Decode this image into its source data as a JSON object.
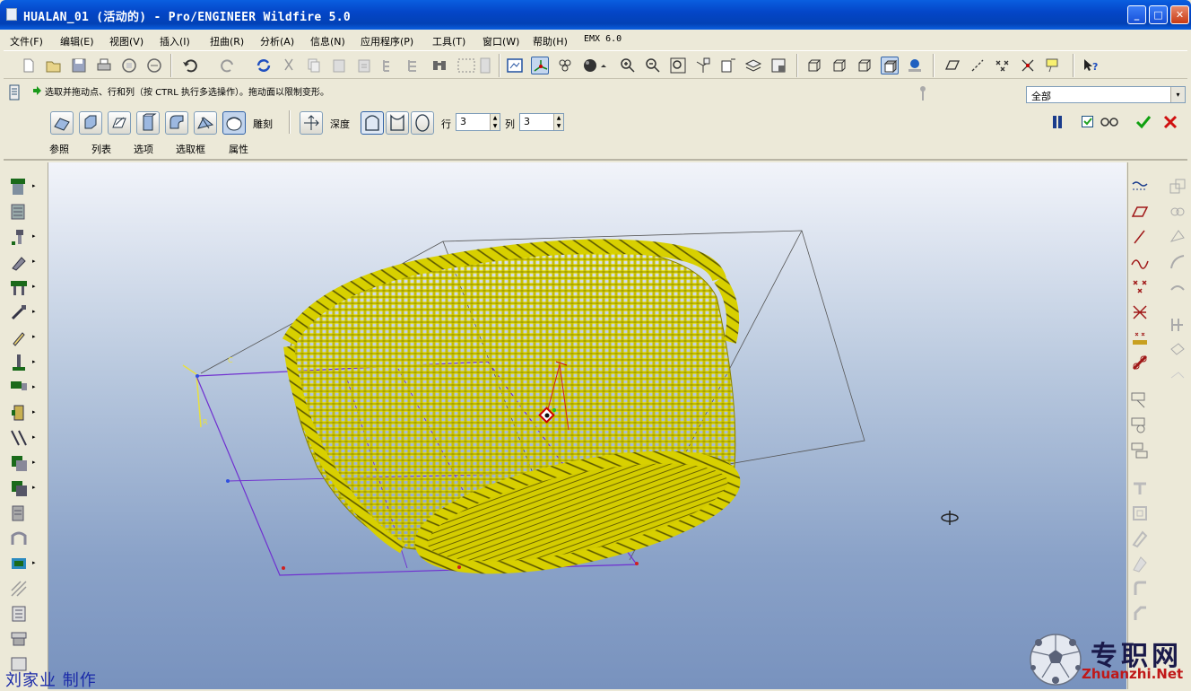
{
  "window": {
    "title": "HUALAN_01 (活动的) - Pro/ENGINEER Wildfire 5.0",
    "min": "_",
    "max": "□",
    "close": "✕"
  },
  "menu": [
    "文件(F)",
    "编辑(E)",
    "视图(V)",
    "插入(I)",
    "扭曲(R)",
    "分析(A)",
    "信息(N)",
    "应用程序(P)",
    "工具(T)",
    "窗口(W)",
    "帮助(H)",
    "EMX 6.0"
  ],
  "message": "选取并拖动点、行和列（按 CTRL 执行多选操作）。拖动面以限制变形。",
  "filter": {
    "value": "全部",
    "arrow": "▾"
  },
  "dashboard": {
    "sculpt_label": "雕刻",
    "depth_label": "深度",
    "row_label": "行",
    "row_value": "3",
    "col_label": "列",
    "col_value": "3",
    "tabs": [
      "参照",
      "列表",
      "选项",
      "选取框",
      "属性"
    ]
  },
  "watermarks": {
    "author": "刘家业 制作",
    "site_cn": "专职网",
    "site_en": "Zhuanzhi.Net"
  },
  "colors": {
    "model": "#e8e000",
    "viewport_top": "#f2f4fa",
    "viewport_bottom": "#7892be",
    "lattice": "#7030d0",
    "ok": "#10a010",
    "cancel": "#d01010"
  },
  "icons": {
    "toolbar": [
      "new-icon",
      "open-icon",
      "save-icon",
      "print-icon",
      "email-icon",
      "email-link-icon",
      "undo-icon",
      "redo-icon",
      "regenerate-icon",
      "cut-icon",
      "copy-icon",
      "paste-icon",
      "paste-special-icon",
      "model-tree-icon",
      "layers-icon",
      "find-icon",
      "select-box-icon",
      "repaint-icon",
      "spin-center-icon",
      "orient-icon",
      "shading-icon",
      "zoom-in-icon",
      "zoom-out-icon",
      "refit-icon",
      "reorient-icon",
      "saved-views-icon",
      "layers-toggle-icon",
      "view-manager-icon",
      "wireframe-icon",
      "hidden-line-icon",
      "no-hidden-icon",
      "shaded-icon",
      "appearance-icon",
      "datum-planes-icon",
      "datum-axes-icon",
      "datum-points-icon",
      "csys-icon",
      "annotation-icon",
      "whats-this-icon"
    ],
    "left": [
      "extrude-icon",
      "revolve-icon",
      "sweep-icon",
      "blend-icon",
      "hole-icon",
      "shell-icon",
      "rib-icon",
      "draft-icon",
      "round-icon",
      "chamfer-icon",
      "pattern-icon",
      "mirror-icon",
      "merge-icon",
      "trim-icon",
      "offset-icon",
      "thicken-icon",
      "solidify-icon",
      "warp-icon",
      "style-icon",
      "boundary-icon"
    ],
    "right": [
      "datum-plane-icon",
      "plane-icon",
      "axis-icon",
      "curve-icon",
      "point-icon",
      "csys-datum-icon",
      "sketch-point-icon",
      "analysis-icon",
      "sketch-icon",
      "mirror-tool-icon",
      "group-icon",
      "copy-feature-icon"
    ]
  }
}
